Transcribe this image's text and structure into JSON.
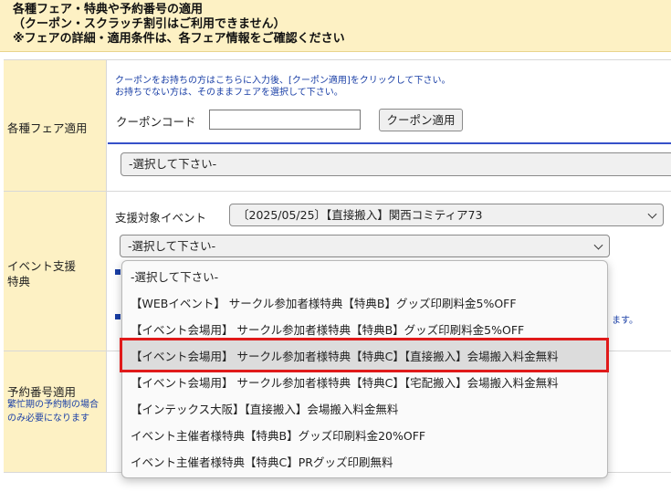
{
  "notice": {
    "line1": "各種フェア・特典や予約番号の適用",
    "line2": "（クーポン・スクラッチ割引はご利用できません）",
    "line3": "※フェアの詳細・適用条件は、各フェア情報をご確認ください"
  },
  "fair": {
    "label": "各種フェア適用",
    "note1": "クーポンをお持ちの方はこちらに入力後、[クーポン適用]をクリックして下さい。",
    "note2": "お持ちでない方は、そのままフェアを選択して下さい。",
    "coupon_label": "クーポンコード",
    "coupon_value": "",
    "coupon_button": "クーポン適用",
    "select_value": "-選択して下さい-"
  },
  "event": {
    "label_line1": "イベント支援",
    "label_line2": "特典",
    "target_label": "支援対象イベント",
    "target_value": "〔2025/05/25〕【直接搬入】関西コミティア73",
    "select_value": "-選択して下さい-",
    "partial_text_right": "ます。"
  },
  "reservation": {
    "label": "予約番号適用",
    "sub": "繁忙期の予約制の場合のみ必要になります"
  },
  "dropdown": {
    "options": [
      "-選択して下さい-",
      "【WEBイベント】 サークル参加者様特典【特典B】グッズ印刷料金5%OFF",
      "【イベント会場用】 サークル参加者様特典【特典B】グッズ印刷料金5%OFF",
      "【イベント会場用】 サークル参加者様特典【特典C】【直接搬入】会場搬入料金無料",
      "【イベント会場用】 サークル参加者様特典【特典C】【宅配搬入】会場搬入料金無料",
      "【インテックス大阪】【直接搬入】会場搬入料金無料",
      "イベント主催者様特典【特典B】グッズ印刷料金20%OFF",
      "イベント主催者様特典【特典C】PRグッズ印刷無料"
    ],
    "highlighted_index": 3,
    "highlight_color": "#e01a1a"
  },
  "colors": {
    "label_bg": "#fdf1c4",
    "accent_blue": "#3650c9",
    "note_blue": "#1a3fa6"
  }
}
